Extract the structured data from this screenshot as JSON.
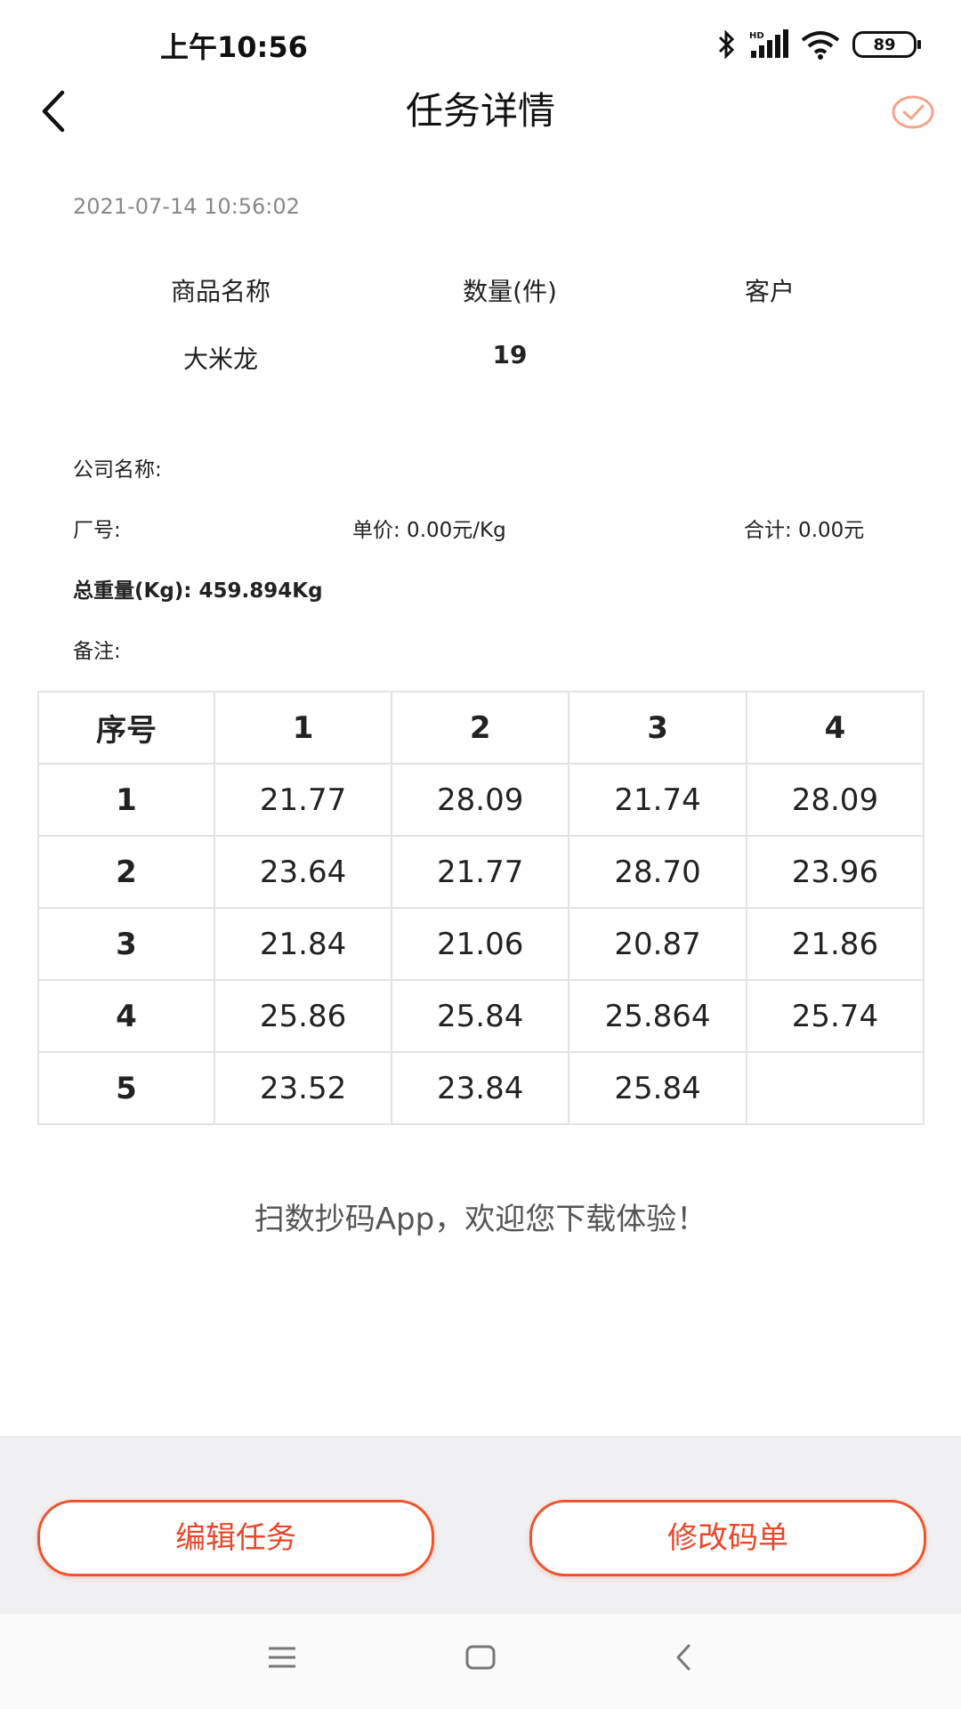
{
  "status_bar": {
    "time": "上午10:56",
    "battery": "89",
    "icons": [
      "bluetooth-icon",
      "signal-hd-icon",
      "wifi-icon",
      "battery-icon"
    ]
  },
  "header": {
    "title": "任务详情",
    "back_icon": "chevron-left-icon",
    "confirm_icon": "check-circle-icon",
    "accent_color": "#f0522e"
  },
  "task": {
    "timestamp": "2021-07-14 10:56:02",
    "columns": [
      "商品名称",
      "数量(件)",
      "客户"
    ],
    "values": [
      "大米龙",
      "19",
      ""
    ]
  },
  "info": {
    "company": "公司名称:",
    "factory": "厂号:",
    "unit_price": "单价: 0.00元/Kg",
    "total": "合计: 0.00元",
    "total_weight": "总重量(Kg): 459.894Kg",
    "remark": "备注:"
  },
  "table": {
    "headers": [
      "序号",
      "1",
      "2",
      "3",
      "4"
    ],
    "rows": [
      [
        "1",
        "21.77",
        "28.09",
        "21.74",
        "28.09"
      ],
      [
        "2",
        "23.64",
        "21.77",
        "28.70",
        "23.96"
      ],
      [
        "3",
        "21.84",
        "21.06",
        "20.87",
        "21.86"
      ],
      [
        "4",
        "25.86",
        "25.84",
        "25.864",
        "25.74"
      ],
      [
        "5",
        "23.52",
        "23.84",
        "25.84",
        ""
      ]
    ]
  },
  "footer_note": "扫数抄码App，欢迎您下载体验！",
  "actions": {
    "edit_label": "编辑任务",
    "modify_label": "修改码单"
  },
  "nav": {
    "icons": [
      "menu-icon",
      "home-square-icon",
      "back-triangle-icon"
    ]
  }
}
